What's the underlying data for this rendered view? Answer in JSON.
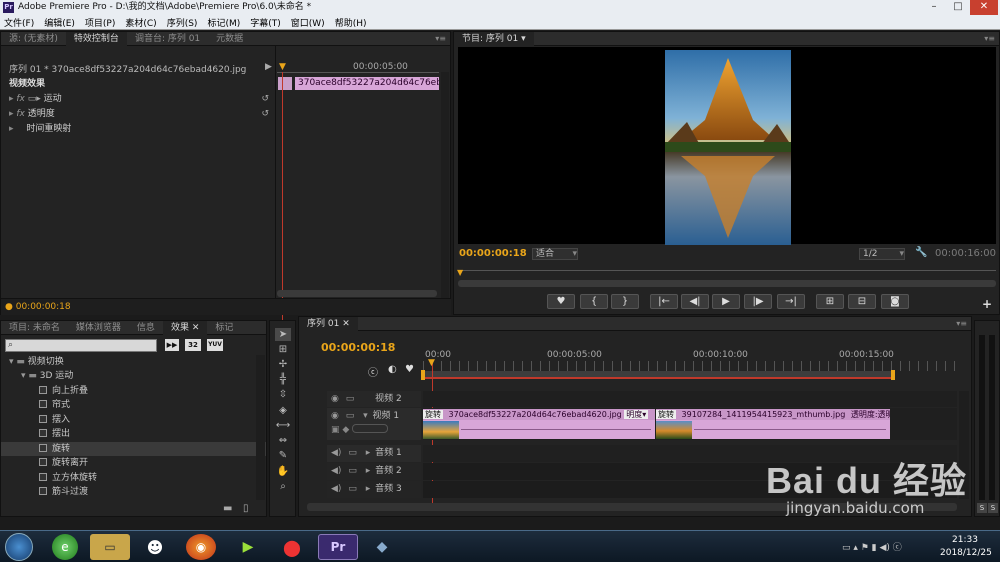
{
  "window": {
    "title": "Adobe Premiere Pro - D:\\我的文档\\Adobe\\Premiere Pro\\6.0\\未命名 *",
    "app_badge": "Pr"
  },
  "menu": [
    "文件(F)",
    "编辑(E)",
    "项目(P)",
    "素材(C)",
    "序列(S)",
    "标记(M)",
    "字幕(T)",
    "窗口(W)",
    "帮助(H)"
  ],
  "source_panel": {
    "tabs": [
      "源: (无素材)",
      "特效控制台",
      "调音台: 序列 01",
      "元数据"
    ],
    "clip_path": "序列 01 * 370ace8df53227a204d64c76ebad4620.jpg",
    "ruler_time": "00:00:05:00",
    "clip_label": "370ace8df53227a204d64c76ebad4",
    "section": "视频效果",
    "effects": [
      {
        "fx": "fx",
        "name": "运动"
      },
      {
        "fx": "fx",
        "name": "透明度"
      },
      {
        "fx": "",
        "name": "时间重映射"
      }
    ],
    "timecode": "00:00:00:18"
  },
  "program_panel": {
    "tab": "节目: 序列 01",
    "timecode": "00:00:00:18",
    "fit": "适合",
    "resolution": "1/2",
    "duration": "00:00:16:00",
    "transport": [
      "♥",
      "{",
      "}",
      "|←",
      "◀|",
      "▶",
      "|▶",
      "→|",
      "⊞",
      "⊟",
      "◙"
    ]
  },
  "project_panel": {
    "tabs": [
      "项目: 未命名",
      "媒体浏览器",
      "信息",
      "效果",
      "标记"
    ],
    "search_placeholder": "",
    "badges": [
      "32",
      "YUV"
    ],
    "tree": [
      {
        "indent": 1,
        "name": "视频切换",
        "kind": "folder"
      },
      {
        "indent": 2,
        "name": "3D 运动",
        "kind": "folder"
      },
      {
        "indent": 3,
        "name": "向上折叠",
        "kind": "item"
      },
      {
        "indent": 3,
        "name": "帘式",
        "kind": "item"
      },
      {
        "indent": 3,
        "name": "摆入",
        "kind": "item"
      },
      {
        "indent": 3,
        "name": "摆出",
        "kind": "item"
      },
      {
        "indent": 3,
        "name": "旋转",
        "kind": "item",
        "selected": true
      },
      {
        "indent": 3,
        "name": "旋转离开",
        "kind": "item"
      },
      {
        "indent": 3,
        "name": "立方体旋转",
        "kind": "item"
      },
      {
        "indent": 3,
        "name": "筋斗过渡",
        "kind": "item"
      }
    ]
  },
  "timeline": {
    "tab": "序列 01",
    "timecode": "00:00:00:18",
    "ruler": [
      "00:00",
      "00:00:05:00",
      "00:00:10:00",
      "00:00:15:00"
    ],
    "tracks": [
      {
        "name": "视频 2",
        "kind": "video"
      },
      {
        "name": "视频 1",
        "kind": "video"
      },
      {
        "name": "音频 1",
        "kind": "audio"
      },
      {
        "name": "音频 2",
        "kind": "audio"
      },
      {
        "name": "音频 3",
        "kind": "audio"
      }
    ],
    "clips": [
      {
        "transition": "旋转",
        "name": "370ace8df53227a204d64c76ebad4620.jpg",
        "fx": "明度▾"
      },
      {
        "transition": "旋转",
        "name": "39107284_1411954415923_mthumb.jpg",
        "fx": "透明度:透明度▾"
      }
    ]
  },
  "tray": {
    "time": "21:33",
    "date": "2018/12/25"
  },
  "watermark": {
    "brand": "Bai du 经验",
    "url": "jingyan.baidu.com"
  },
  "colors": {
    "accent": "#e9a51a",
    "clip": "#d8a6d8",
    "playhead": "#c0392b"
  }
}
